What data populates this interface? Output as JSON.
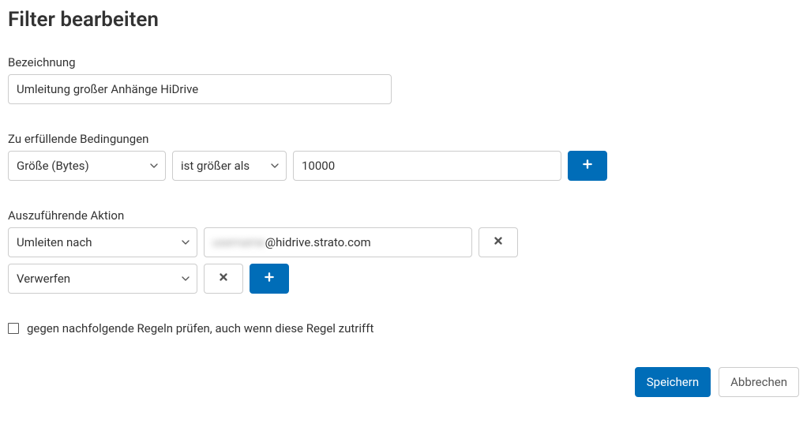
{
  "title": "Filter bearbeiten",
  "name": {
    "label": "Bezeichnung",
    "value": "Umleitung großer Anhänge HiDrive"
  },
  "conditions": {
    "label": "Zu erfüllende Bedingungen",
    "rows": [
      {
        "field": "Größe (Bytes)",
        "operator": "ist größer als",
        "value": "10000"
      }
    ]
  },
  "actions": {
    "label": "Auszuführende Aktion",
    "rows": [
      {
        "action": "Umleiten nach",
        "value_prefix_hidden": "username",
        "value_suffix": "@hidrive.strato.com",
        "has_value": true
      },
      {
        "action": "Verwerfen",
        "has_value": false
      }
    ]
  },
  "stop_checkbox": {
    "checked": false,
    "label": "gegen nachfolgende Regeln prüfen, auch wenn diese Regel zutrifft"
  },
  "buttons": {
    "save": "Speichern",
    "cancel": "Abbrechen"
  },
  "icons": {
    "plus": "plus",
    "remove": "x"
  }
}
